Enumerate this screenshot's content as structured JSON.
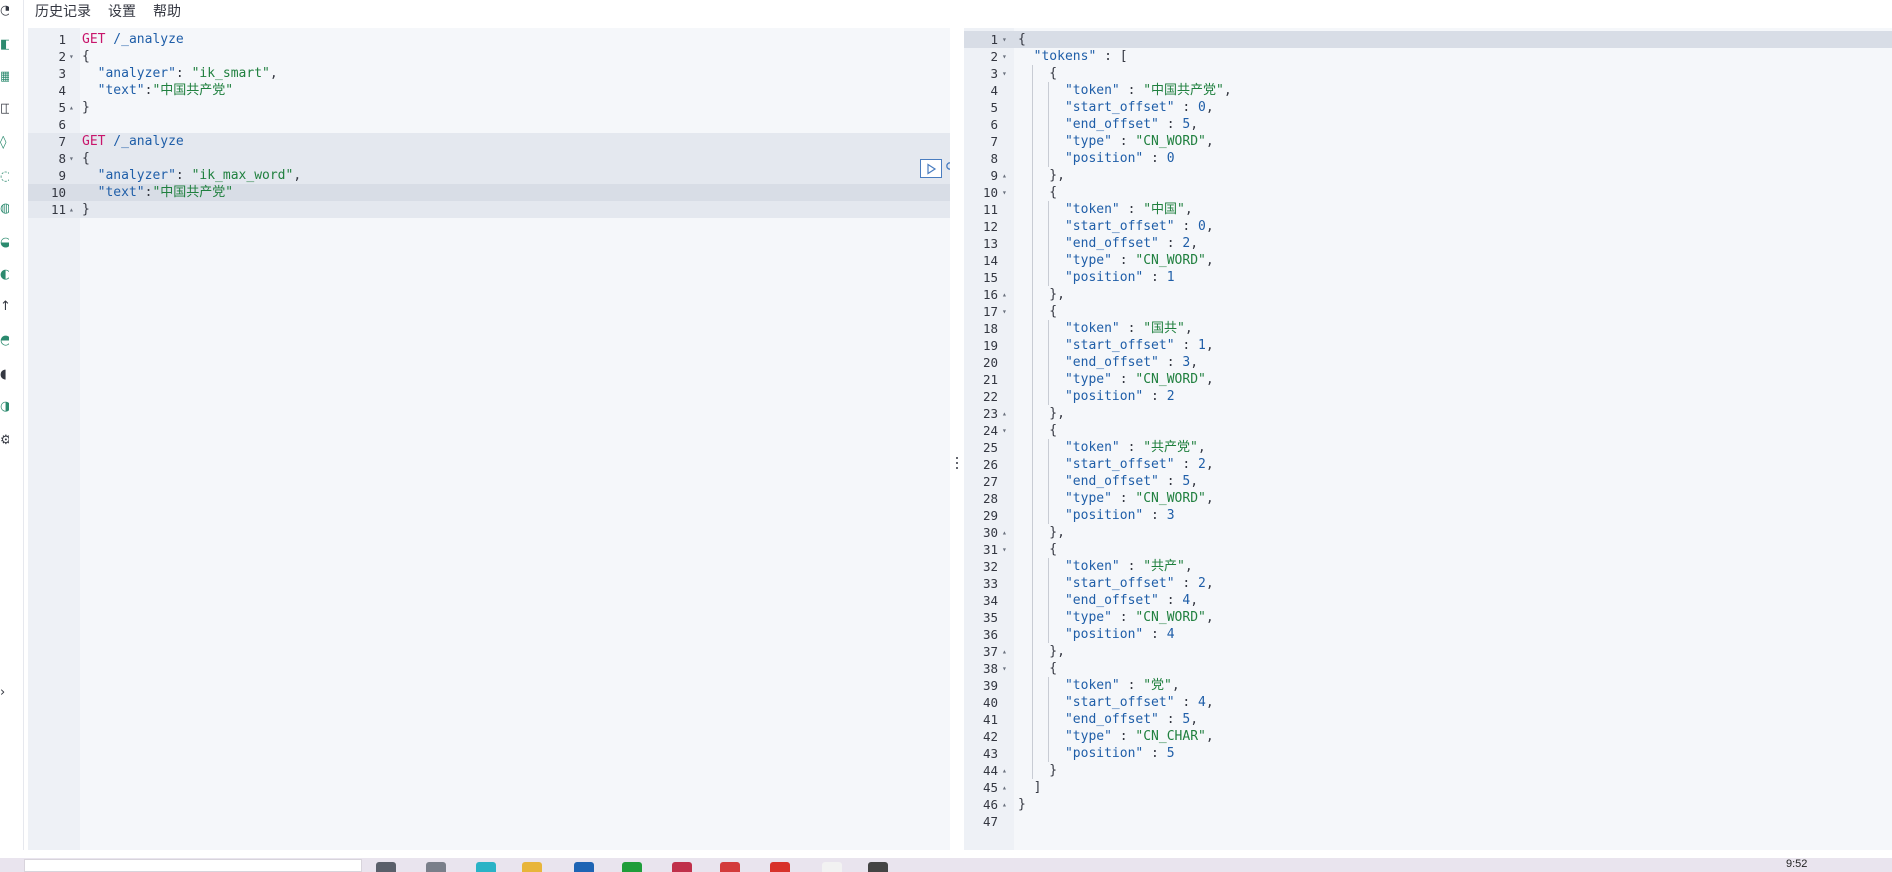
{
  "menu": {
    "items": [
      "历史记录",
      "设置",
      "帮助"
    ]
  },
  "request": {
    "lines": [
      {
        "n": "1",
        "fold": "",
        "parts": [
          {
            "t": "GET",
            "c": "kw"
          },
          {
            "t": " /_analyze",
            "c": "url"
          }
        ]
      },
      {
        "n": "2",
        "fold": "▾",
        "parts": [
          {
            "t": "{",
            "c": ""
          }
        ]
      },
      {
        "n": "3",
        "fold": "",
        "parts": [
          {
            "t": "  \"analyzer\"",
            "c": "key"
          },
          {
            "t": ": ",
            "c": ""
          },
          {
            "t": "\"ik_smart\"",
            "c": "str"
          },
          {
            "t": ",",
            "c": ""
          }
        ]
      },
      {
        "n": "4",
        "fold": "",
        "parts": [
          {
            "t": "  \"text\"",
            "c": "key"
          },
          {
            "t": ":",
            "c": ""
          },
          {
            "t": "\"中国共产党\"",
            "c": "str"
          }
        ]
      },
      {
        "n": "5",
        "fold": "▴",
        "parts": [
          {
            "t": "}",
            "c": ""
          }
        ]
      },
      {
        "n": "6",
        "fold": "",
        "parts": []
      },
      {
        "n": "7",
        "fold": "",
        "parts": [
          {
            "t": "GET",
            "c": "kw"
          },
          {
            "t": " /_analyze",
            "c": "url"
          }
        ]
      },
      {
        "n": "8",
        "fold": "▾",
        "parts": [
          {
            "t": "{",
            "c": ""
          }
        ]
      },
      {
        "n": "9",
        "fold": "",
        "parts": [
          {
            "t": "  \"analyzer\"",
            "c": "key"
          },
          {
            "t": ": ",
            "c": ""
          },
          {
            "t": "\"ik_max_word\"",
            "c": "str"
          },
          {
            "t": ",",
            "c": ""
          }
        ]
      },
      {
        "n": "10",
        "fold": "",
        "parts": [
          {
            "t": "  \"text\"",
            "c": "key"
          },
          {
            "t": ":",
            "c": ""
          },
          {
            "t": "\"中国共产党\"",
            "c": "str"
          }
        ]
      },
      {
        "n": "11",
        "fold": "▴",
        "parts": [
          {
            "t": "}",
            "c": ""
          }
        ]
      }
    ],
    "block_lines": [
      7,
      8,
      9,
      10,
      11
    ],
    "active_line": 10
  },
  "response": {
    "lines": [
      {
        "n": "1",
        "fold": "▾",
        "parts": [
          {
            "t": "{",
            "c": ""
          }
        ]
      },
      {
        "n": "2",
        "fold": "▾",
        "parts": [
          {
            "t": "  \"tokens\"",
            "c": "key"
          },
          {
            "t": " : [",
            "c": ""
          }
        ]
      },
      {
        "n": "3",
        "fold": "▾",
        "parts": [
          {
            "t": "    {",
            "c": ""
          }
        ]
      },
      {
        "n": "4",
        "fold": "",
        "parts": [
          {
            "t": "      \"token\"",
            "c": "key"
          },
          {
            "t": " : ",
            "c": ""
          },
          {
            "t": "\"中国共产党\"",
            "c": "str"
          },
          {
            "t": ",",
            "c": ""
          }
        ]
      },
      {
        "n": "5",
        "fold": "",
        "parts": [
          {
            "t": "      \"start_offset\"",
            "c": "key"
          },
          {
            "t": " : ",
            "c": ""
          },
          {
            "t": "0",
            "c": "num"
          },
          {
            "t": ",",
            "c": ""
          }
        ]
      },
      {
        "n": "6",
        "fold": "",
        "parts": [
          {
            "t": "      \"end_offset\"",
            "c": "key"
          },
          {
            "t": " : ",
            "c": ""
          },
          {
            "t": "5",
            "c": "num"
          },
          {
            "t": ",",
            "c": ""
          }
        ]
      },
      {
        "n": "7",
        "fold": "",
        "parts": [
          {
            "t": "      \"type\"",
            "c": "key"
          },
          {
            "t": " : ",
            "c": ""
          },
          {
            "t": "\"CN_WORD\"",
            "c": "str"
          },
          {
            "t": ",",
            "c": ""
          }
        ]
      },
      {
        "n": "8",
        "fold": "",
        "parts": [
          {
            "t": "      \"position\"",
            "c": "key"
          },
          {
            "t": " : ",
            "c": ""
          },
          {
            "t": "0",
            "c": "num"
          }
        ]
      },
      {
        "n": "9",
        "fold": "▴",
        "parts": [
          {
            "t": "    },",
            "c": ""
          }
        ]
      },
      {
        "n": "10",
        "fold": "▾",
        "parts": [
          {
            "t": "    {",
            "c": ""
          }
        ]
      },
      {
        "n": "11",
        "fold": "",
        "parts": [
          {
            "t": "      \"token\"",
            "c": "key"
          },
          {
            "t": " : ",
            "c": ""
          },
          {
            "t": "\"中国\"",
            "c": "str"
          },
          {
            "t": ",",
            "c": ""
          }
        ]
      },
      {
        "n": "12",
        "fold": "",
        "parts": [
          {
            "t": "      \"start_offset\"",
            "c": "key"
          },
          {
            "t": " : ",
            "c": ""
          },
          {
            "t": "0",
            "c": "num"
          },
          {
            "t": ",",
            "c": ""
          }
        ]
      },
      {
        "n": "13",
        "fold": "",
        "parts": [
          {
            "t": "      \"end_offset\"",
            "c": "key"
          },
          {
            "t": " : ",
            "c": ""
          },
          {
            "t": "2",
            "c": "num"
          },
          {
            "t": ",",
            "c": ""
          }
        ]
      },
      {
        "n": "14",
        "fold": "",
        "parts": [
          {
            "t": "      \"type\"",
            "c": "key"
          },
          {
            "t": " : ",
            "c": ""
          },
          {
            "t": "\"CN_WORD\"",
            "c": "str"
          },
          {
            "t": ",",
            "c": ""
          }
        ]
      },
      {
        "n": "15",
        "fold": "",
        "parts": [
          {
            "t": "      \"position\"",
            "c": "key"
          },
          {
            "t": " : ",
            "c": ""
          },
          {
            "t": "1",
            "c": "num"
          }
        ]
      },
      {
        "n": "16",
        "fold": "▴",
        "parts": [
          {
            "t": "    },",
            "c": ""
          }
        ]
      },
      {
        "n": "17",
        "fold": "▾",
        "parts": [
          {
            "t": "    {",
            "c": ""
          }
        ]
      },
      {
        "n": "18",
        "fold": "",
        "parts": [
          {
            "t": "      \"token\"",
            "c": "key"
          },
          {
            "t": " : ",
            "c": ""
          },
          {
            "t": "\"国共\"",
            "c": "str"
          },
          {
            "t": ",",
            "c": ""
          }
        ]
      },
      {
        "n": "19",
        "fold": "",
        "parts": [
          {
            "t": "      \"start_offset\"",
            "c": "key"
          },
          {
            "t": " : ",
            "c": ""
          },
          {
            "t": "1",
            "c": "num"
          },
          {
            "t": ",",
            "c": ""
          }
        ]
      },
      {
        "n": "20",
        "fold": "",
        "parts": [
          {
            "t": "      \"end_offset\"",
            "c": "key"
          },
          {
            "t": " : ",
            "c": ""
          },
          {
            "t": "3",
            "c": "num"
          },
          {
            "t": ",",
            "c": ""
          }
        ]
      },
      {
        "n": "21",
        "fold": "",
        "parts": [
          {
            "t": "      \"type\"",
            "c": "key"
          },
          {
            "t": " : ",
            "c": ""
          },
          {
            "t": "\"CN_WORD\"",
            "c": "str"
          },
          {
            "t": ",",
            "c": ""
          }
        ]
      },
      {
        "n": "22",
        "fold": "",
        "parts": [
          {
            "t": "      \"position\"",
            "c": "key"
          },
          {
            "t": " : ",
            "c": ""
          },
          {
            "t": "2",
            "c": "num"
          }
        ]
      },
      {
        "n": "23",
        "fold": "▴",
        "parts": [
          {
            "t": "    },",
            "c": ""
          }
        ]
      },
      {
        "n": "24",
        "fold": "▾",
        "parts": [
          {
            "t": "    {",
            "c": ""
          }
        ]
      },
      {
        "n": "25",
        "fold": "",
        "parts": [
          {
            "t": "      \"token\"",
            "c": "key"
          },
          {
            "t": " : ",
            "c": ""
          },
          {
            "t": "\"共产党\"",
            "c": "str"
          },
          {
            "t": ",",
            "c": ""
          }
        ]
      },
      {
        "n": "26",
        "fold": "",
        "parts": [
          {
            "t": "      \"start_offset\"",
            "c": "key"
          },
          {
            "t": " : ",
            "c": ""
          },
          {
            "t": "2",
            "c": "num"
          },
          {
            "t": ",",
            "c": ""
          }
        ]
      },
      {
        "n": "27",
        "fold": "",
        "parts": [
          {
            "t": "      \"end_offset\"",
            "c": "key"
          },
          {
            "t": " : ",
            "c": ""
          },
          {
            "t": "5",
            "c": "num"
          },
          {
            "t": ",",
            "c": ""
          }
        ]
      },
      {
        "n": "28",
        "fold": "",
        "parts": [
          {
            "t": "      \"type\"",
            "c": "key"
          },
          {
            "t": " : ",
            "c": ""
          },
          {
            "t": "\"CN_WORD\"",
            "c": "str"
          },
          {
            "t": ",",
            "c": ""
          }
        ]
      },
      {
        "n": "29",
        "fold": "",
        "parts": [
          {
            "t": "      \"position\"",
            "c": "key"
          },
          {
            "t": " : ",
            "c": ""
          },
          {
            "t": "3",
            "c": "num"
          }
        ]
      },
      {
        "n": "30",
        "fold": "▴",
        "parts": [
          {
            "t": "    },",
            "c": ""
          }
        ]
      },
      {
        "n": "31",
        "fold": "▾",
        "parts": [
          {
            "t": "    {",
            "c": ""
          }
        ]
      },
      {
        "n": "32",
        "fold": "",
        "parts": [
          {
            "t": "      \"token\"",
            "c": "key"
          },
          {
            "t": " : ",
            "c": ""
          },
          {
            "t": "\"共产\"",
            "c": "str"
          },
          {
            "t": ",",
            "c": ""
          }
        ]
      },
      {
        "n": "33",
        "fold": "",
        "parts": [
          {
            "t": "      \"start_offset\"",
            "c": "key"
          },
          {
            "t": " : ",
            "c": ""
          },
          {
            "t": "2",
            "c": "num"
          },
          {
            "t": ",",
            "c": ""
          }
        ]
      },
      {
        "n": "34",
        "fold": "",
        "parts": [
          {
            "t": "      \"end_offset\"",
            "c": "key"
          },
          {
            "t": " : ",
            "c": ""
          },
          {
            "t": "4",
            "c": "num"
          },
          {
            "t": ",",
            "c": ""
          }
        ]
      },
      {
        "n": "35",
        "fold": "",
        "parts": [
          {
            "t": "      \"type\"",
            "c": "key"
          },
          {
            "t": " : ",
            "c": ""
          },
          {
            "t": "\"CN_WORD\"",
            "c": "str"
          },
          {
            "t": ",",
            "c": ""
          }
        ]
      },
      {
        "n": "36",
        "fold": "",
        "parts": [
          {
            "t": "      \"position\"",
            "c": "key"
          },
          {
            "t": " : ",
            "c": ""
          },
          {
            "t": "4",
            "c": "num"
          }
        ]
      },
      {
        "n": "37",
        "fold": "▴",
        "parts": [
          {
            "t": "    },",
            "c": ""
          }
        ]
      },
      {
        "n": "38",
        "fold": "▾",
        "parts": [
          {
            "t": "    {",
            "c": ""
          }
        ]
      },
      {
        "n": "39",
        "fold": "",
        "parts": [
          {
            "t": "      \"token\"",
            "c": "key"
          },
          {
            "t": " : ",
            "c": ""
          },
          {
            "t": "\"党\"",
            "c": "str"
          },
          {
            "t": ",",
            "c": ""
          }
        ]
      },
      {
        "n": "40",
        "fold": "",
        "parts": [
          {
            "t": "      \"start_offset\"",
            "c": "key"
          },
          {
            "t": " : ",
            "c": ""
          },
          {
            "t": "4",
            "c": "num"
          },
          {
            "t": ",",
            "c": ""
          }
        ]
      },
      {
        "n": "41",
        "fold": "",
        "parts": [
          {
            "t": "      \"end_offset\"",
            "c": "key"
          },
          {
            "t": " : ",
            "c": ""
          },
          {
            "t": "5",
            "c": "num"
          },
          {
            "t": ",",
            "c": ""
          }
        ]
      },
      {
        "n": "42",
        "fold": "",
        "parts": [
          {
            "t": "      \"type\"",
            "c": "key"
          },
          {
            "t": " : ",
            "c": ""
          },
          {
            "t": "\"CN_CHAR\"",
            "c": "str"
          },
          {
            "t": ",",
            "c": ""
          }
        ]
      },
      {
        "n": "43",
        "fold": "",
        "parts": [
          {
            "t": "      \"position\"",
            "c": "key"
          },
          {
            "t": " : ",
            "c": ""
          },
          {
            "t": "5",
            "c": "num"
          }
        ]
      },
      {
        "n": "44",
        "fold": "▴",
        "parts": [
          {
            "t": "    }",
            "c": ""
          }
        ]
      },
      {
        "n": "45",
        "fold": "▴",
        "parts": [
          {
            "t": "  ]",
            "c": ""
          }
        ]
      },
      {
        "n": "46",
        "fold": "▴",
        "parts": [
          {
            "t": "}",
            "c": ""
          }
        ]
      },
      {
        "n": "47",
        "fold": "",
        "parts": []
      }
    ],
    "active_line": 1
  },
  "taskbar": {
    "clock": "9:52"
  },
  "icons": {
    "run": "play-icon",
    "wrench": "wrench-icon",
    "resizer": "vertical-ellipsis-icon"
  },
  "colors": {
    "keyword": "#c8156b",
    "string": "#20803f",
    "key": "#1f5ea8",
    "pane_bg": "#f5f7fa",
    "gutter_bg": "#eef1f6",
    "active_line": "#d8dde6"
  }
}
